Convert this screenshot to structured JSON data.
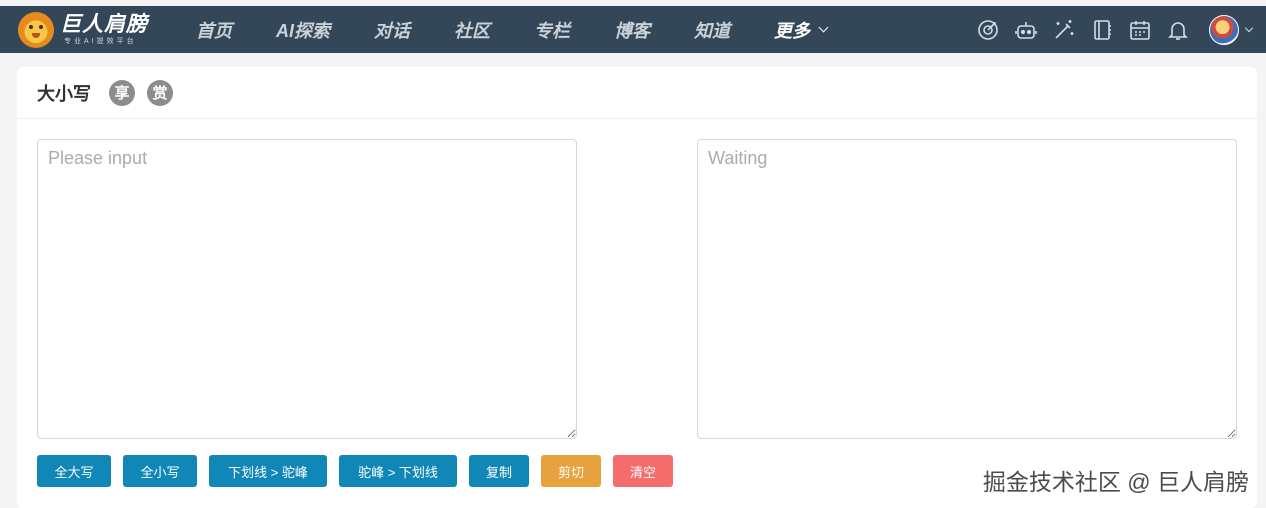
{
  "navbar": {
    "logo": {
      "title": "巨人肩膀",
      "subtitle": "专业AI提效平台"
    },
    "items": [
      {
        "label": "首页"
      },
      {
        "label": "AI探索"
      },
      {
        "label": "对话"
      },
      {
        "label": "社区"
      },
      {
        "label": "专栏"
      },
      {
        "label": "博客"
      },
      {
        "label": "知道"
      }
    ],
    "more_label": "更多",
    "icons": [
      "target-icon",
      "robot-icon",
      "magic-wand-icon",
      "notebook-icon",
      "calendar-icon",
      "bell-icon"
    ],
    "bg_color": "#344759"
  },
  "card": {
    "title": "大小写",
    "badges": [
      "享",
      "赏"
    ]
  },
  "input": {
    "placeholder": "Please input",
    "value": ""
  },
  "output": {
    "placeholder": "Waiting",
    "value": ""
  },
  "buttons": {
    "upper": "全大写",
    "lower": "全小写",
    "snake_to_camel": "下划线 > 驼峰",
    "camel_to_snake": "驼峰 > 下划线",
    "copy": "复制",
    "cut": "剪切",
    "clear": "清空"
  },
  "colors": {
    "primary": "#1187b8",
    "warning": "#e6a23c",
    "danger": "#f56c6c"
  },
  "watermark": "掘金技术社区 @ 巨人肩膀"
}
